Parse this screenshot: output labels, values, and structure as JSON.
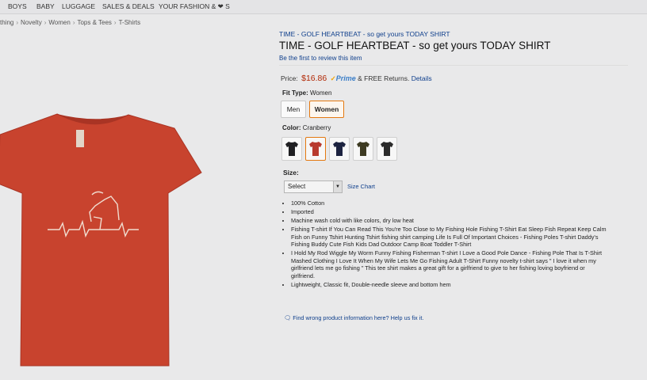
{
  "nav": {
    "items": [
      "BOYS",
      "BABY",
      "LUGGAGE",
      "SALES & DEALS",
      "YOUR FASHION & ❤ S"
    ]
  },
  "breadcrumb": [
    "thing",
    "Novelty",
    "Women",
    "Tops & Tees",
    "T-Shirts"
  ],
  "breadcrumb_sep": "›",
  "product": {
    "title_link": "TIME - GOLF HEARTBEAT - so get yours TODAY SHIRT",
    "title": "TIME - GOLF HEARTBEAT - so get yours TODAY SHIRT",
    "review_link": "Be the first to review this item",
    "shirt_color": "#c8432e"
  },
  "price": {
    "label": "Price:",
    "value": "$16.86",
    "prime_check": "✓",
    "prime": "Prime",
    "returns": "& FREE Returns.",
    "details": "Details"
  },
  "fit": {
    "label": "Fit Type:",
    "selected": "Women",
    "options": [
      "Men",
      "Women"
    ]
  },
  "color": {
    "label": "Color:",
    "selected": "Cranberry",
    "swatches": [
      {
        "name": "black",
        "hex": "#1f1f22"
      },
      {
        "name": "cranberry",
        "hex": "#b83a2e"
      },
      {
        "name": "navy",
        "hex": "#1d2340"
      },
      {
        "name": "olive",
        "hex": "#3d3a22"
      },
      {
        "name": "charcoal",
        "hex": "#2b2b2b"
      }
    ]
  },
  "size": {
    "label": "Size:",
    "select_value": "Select",
    "chart_link": "Size Chart"
  },
  "features": [
    "100% Cotton",
    "Imported",
    "Machine wash cold with like colors, dry low heat",
    "Fishing T-shirt If You Can Read This You're Too Close to My Fishing Hole Fishing T-Shirt Eat Sleep Fish Repeat Keep Calm Fish on Funny Tshirt Hunting Tshirt fishing shirt camping Life Is Full Of Important Choices - Fishing Poles T-shirt Daddy's Fishing Buddy Cute Fish Kids Dad Outdoor Camp Boat Toddler T-Shirt",
    "I Hold My Rod Wiggle My Worm Funny Fishing Fisherman T-shirt I Love a Good Pole Dance - Fishing Pole That Is T-Shirt Mashed Clothing I Love It When My Wife Lets Me Go Fishing Adult T-Shirt Funny novelty t-shirt says \" I love it when my girlfriend lets me go fishing \" This tee shirt makes a great gift for a girlfriend to give to her fishing loving boyfriend or girlfriend.",
    "Lightweight, Classic fit, Double-needle sleeve and bottom hem"
  ],
  "feedback": "Find wrong product information here? Help us fix it."
}
